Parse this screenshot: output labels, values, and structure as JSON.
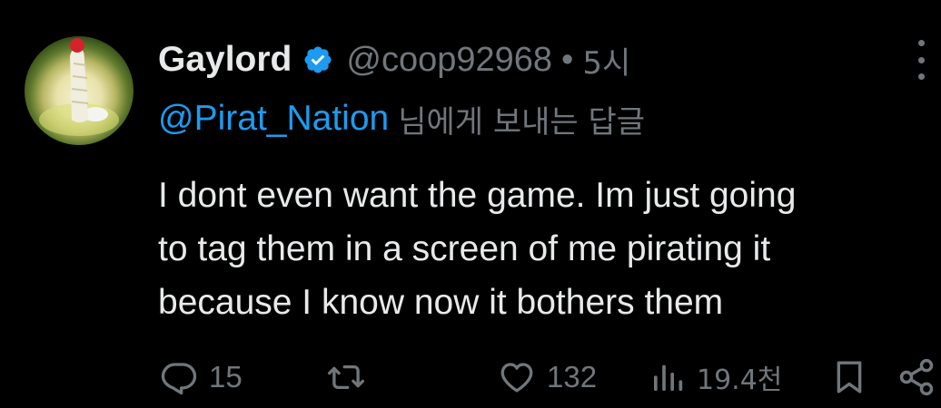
{
  "tweet": {
    "author": {
      "display_name": "Gaylord",
      "handle": "@coop92968",
      "verified": true,
      "verified_color": "#1d9bf0"
    },
    "separator": "•",
    "time": "5시",
    "reply_to": {
      "mention": "@Pirat_Nation",
      "suffix": "님에게 보내는 답글"
    },
    "text_lines": [
      "I dont even want the game. Im just going",
      "to tag them in a screen of me pirating it",
      "because I know now it bothers them"
    ],
    "actions": {
      "replies": "15",
      "retweets": "",
      "likes": "132",
      "views": "19.4천"
    }
  },
  "colors": {
    "background": "#000000",
    "text_primary": "#e7e9ea",
    "text_secondary": "#71767b",
    "accent": "#1d9bf0"
  },
  "icons": {
    "more": "more-dots-icon",
    "reply": "reply-icon",
    "retweet": "retweet-icon",
    "like": "heart-icon",
    "views": "views-icon",
    "bookmark": "bookmark-icon",
    "share": "share-icon"
  }
}
